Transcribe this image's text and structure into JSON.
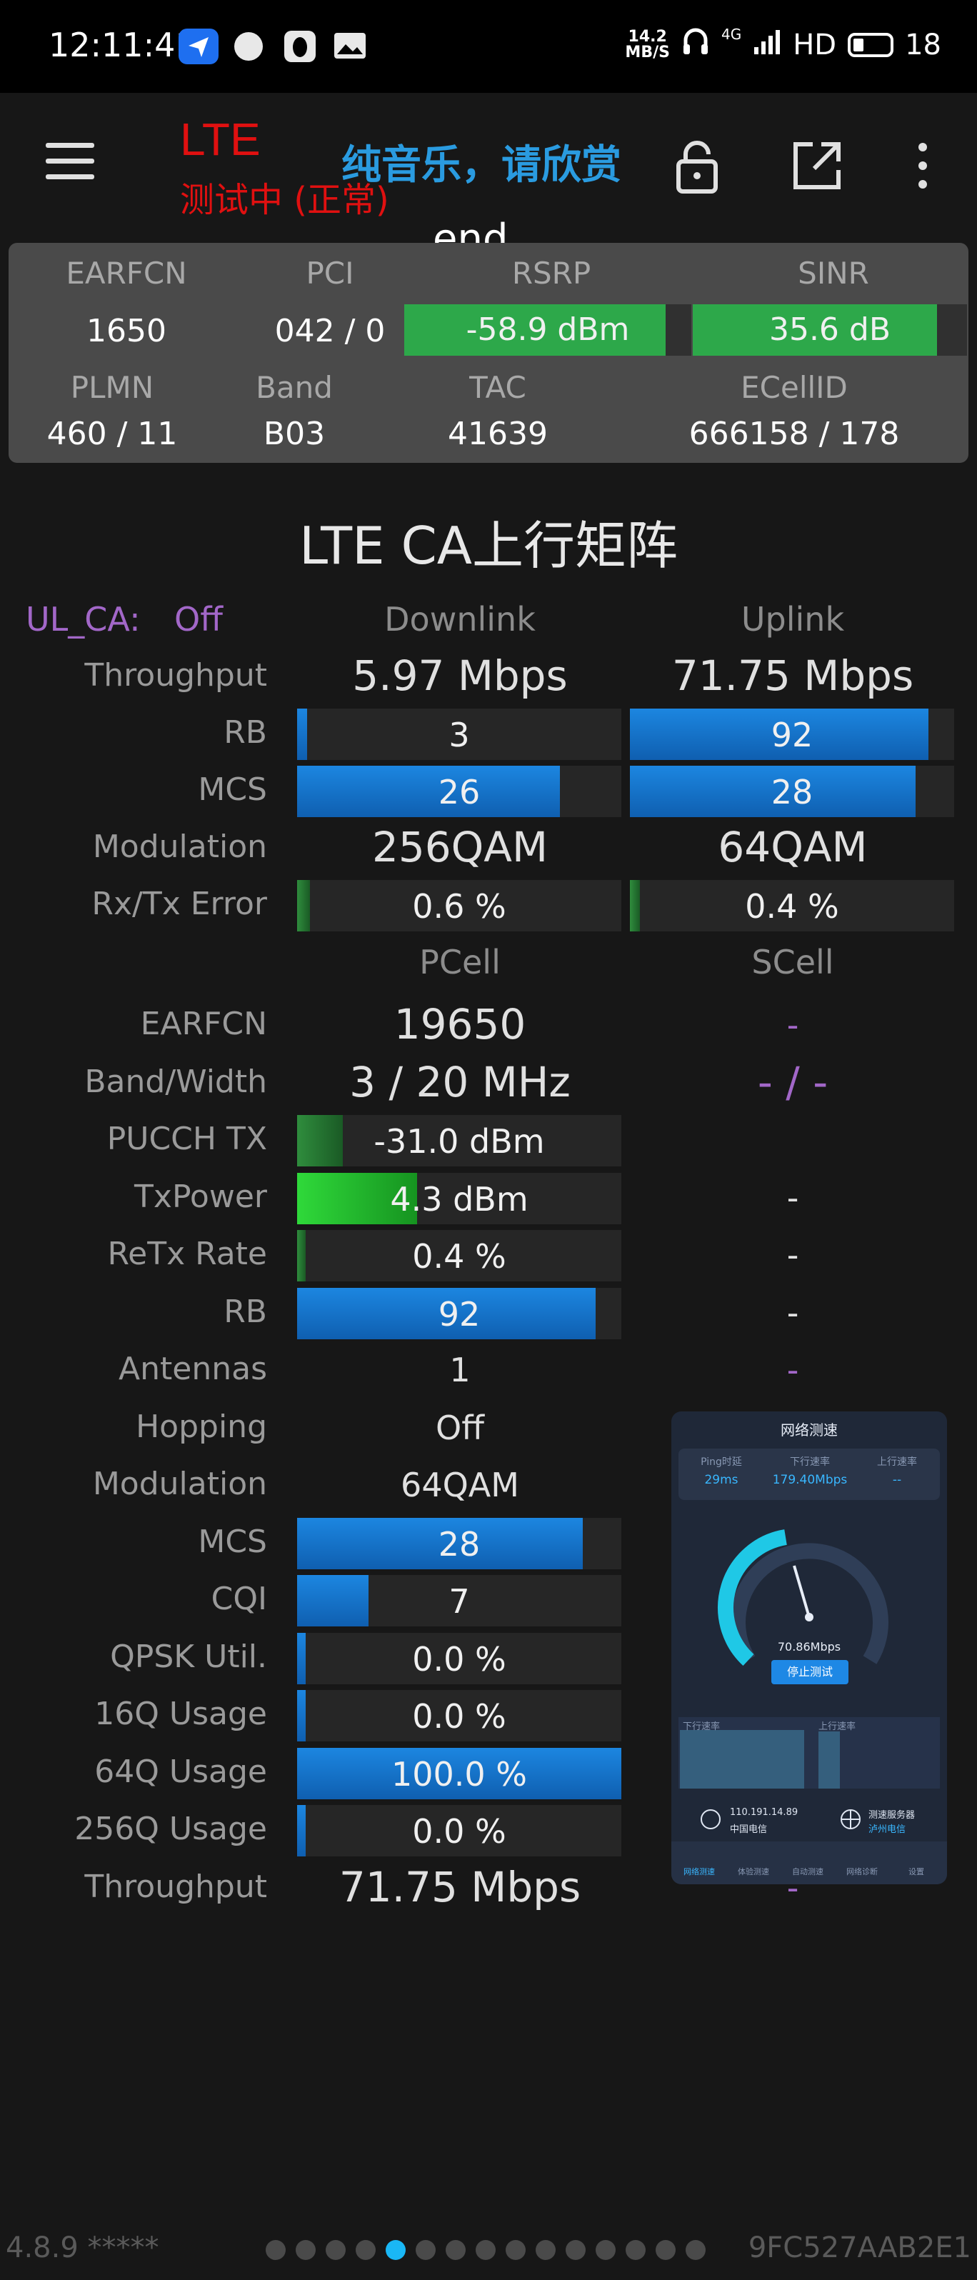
{
  "status_bar": {
    "time": "12:11:41",
    "net_speed_value": "14.2",
    "net_speed_unit": "MB/S",
    "network": "4G",
    "hd": "HD",
    "battery": "18"
  },
  "app_bar": {
    "mode": "LTE",
    "status": "测试中 (正常)",
    "music": "纯音乐，请欣赏",
    "ticker": "end..."
  },
  "cell_card": {
    "headers": [
      "EARFCN",
      "PCI",
      "RSRP",
      "SINR",
      "PLMN",
      "Band",
      "TAC",
      "ECellID"
    ],
    "earfcn": "1650",
    "pci": "042 / 0",
    "rsrp": "-58.9 dBm",
    "rsrp_level": 0.91,
    "sinr": "35.6 dB",
    "sinr_level": 0.89,
    "plmn": "460 / 11",
    "band": "B03",
    "tac": "41639",
    "ecellid": "666158 / 178"
  },
  "matrix": {
    "title": "LTE CA上行矩阵",
    "ul_ca_label": "UL_CA:",
    "ul_ca_value": "Off",
    "col_downlink": "Downlink",
    "col_uplink": "Uplink",
    "labels": {
      "throughput": "Throughput",
      "rb": "RB",
      "mcs": "MCS",
      "modulation": "Modulation",
      "rxtx_error": "Rx/Tx Error"
    },
    "downlink": {
      "throughput": "5.97 Mbps",
      "rb": "3",
      "rb_level": 0.03,
      "mcs": "26",
      "mcs_level": 0.81,
      "modulation": "256QAM",
      "error": "0.6 %",
      "error_level": 0.04
    },
    "uplink": {
      "throughput": "71.75 Mbps",
      "rb": "92",
      "rb_level": 0.92,
      "mcs": "28",
      "mcs_level": 0.88,
      "modulation": "64QAM",
      "error": "0.4 %",
      "error_level": 0.03
    },
    "col_pcell": "PCell",
    "col_scell": "SCell",
    "cell_labels": {
      "earfcn": "EARFCN",
      "band_width": "Band/Width",
      "pucch_tx": "PUCCH TX",
      "txpower": "TxPower",
      "retx_rate": "ReTx Rate",
      "rb": "RB",
      "antennas": "Antennas",
      "hopping": "Hopping",
      "modulation": "Modulation",
      "mcs": "MCS",
      "cqi": "CQI",
      "qpsk": "QPSK Util.",
      "q16": "16Q Usage",
      "q64": "64Q Usage",
      "q256": "256Q Usage",
      "throughput": "Throughput"
    },
    "pcell": {
      "earfcn": "19650",
      "band_width": "3 / 20 MHz",
      "pucch_tx": "-31.0 dBm",
      "pucch_level": 0.14,
      "txpower": "4.3 dBm",
      "txpower_level": 0.37,
      "retx_rate": "0.4 %",
      "retx_level": 0.02,
      "rb": "92",
      "rb_level": 0.92,
      "antennas": "1",
      "hopping": "Off",
      "modulation": "64QAM",
      "mcs": "28",
      "mcs_level": 0.88,
      "cqi": "7",
      "cqi_level": 0.22,
      "qpsk": "0.0 %",
      "qpsk_level": 0.02,
      "q16": "0.0 %",
      "q16_level": 0.02,
      "q64": "100.0 %",
      "q64_level": 1.0,
      "q256": "0.0 %",
      "q256_level": 0.02,
      "throughput": "71.75 Mbps"
    },
    "scell": {
      "earfcn": "-",
      "band_width": "- / -",
      "txpower": "-",
      "retx_rate": "-",
      "rb": "-",
      "antennas": "-",
      "throughput": "-"
    }
  },
  "speedtest": {
    "title": "网络测速",
    "ping_label": "Ping时延",
    "ping_value": "29ms",
    "down_label": "下行速率",
    "down_value": "179.40Mbps",
    "up_label": "上行速率",
    "up_value": "--",
    "reading": "70.86Mbps",
    "stop_button": "停止测试",
    "graph_down": "下行速率",
    "graph_up": "上行速率",
    "ip": "110.191.14.89",
    "carrier": "中国电信",
    "server_label": "测速服务器",
    "server_name": "泸州电信",
    "tabs": [
      "网络测速",
      "体验测速",
      "自动测速",
      "网络诊断",
      "设置"
    ]
  },
  "footer": {
    "version": "4.8.9 *****",
    "device_id": "9FC527AAB2E1",
    "page_count": 15,
    "active_page": 4
  }
}
